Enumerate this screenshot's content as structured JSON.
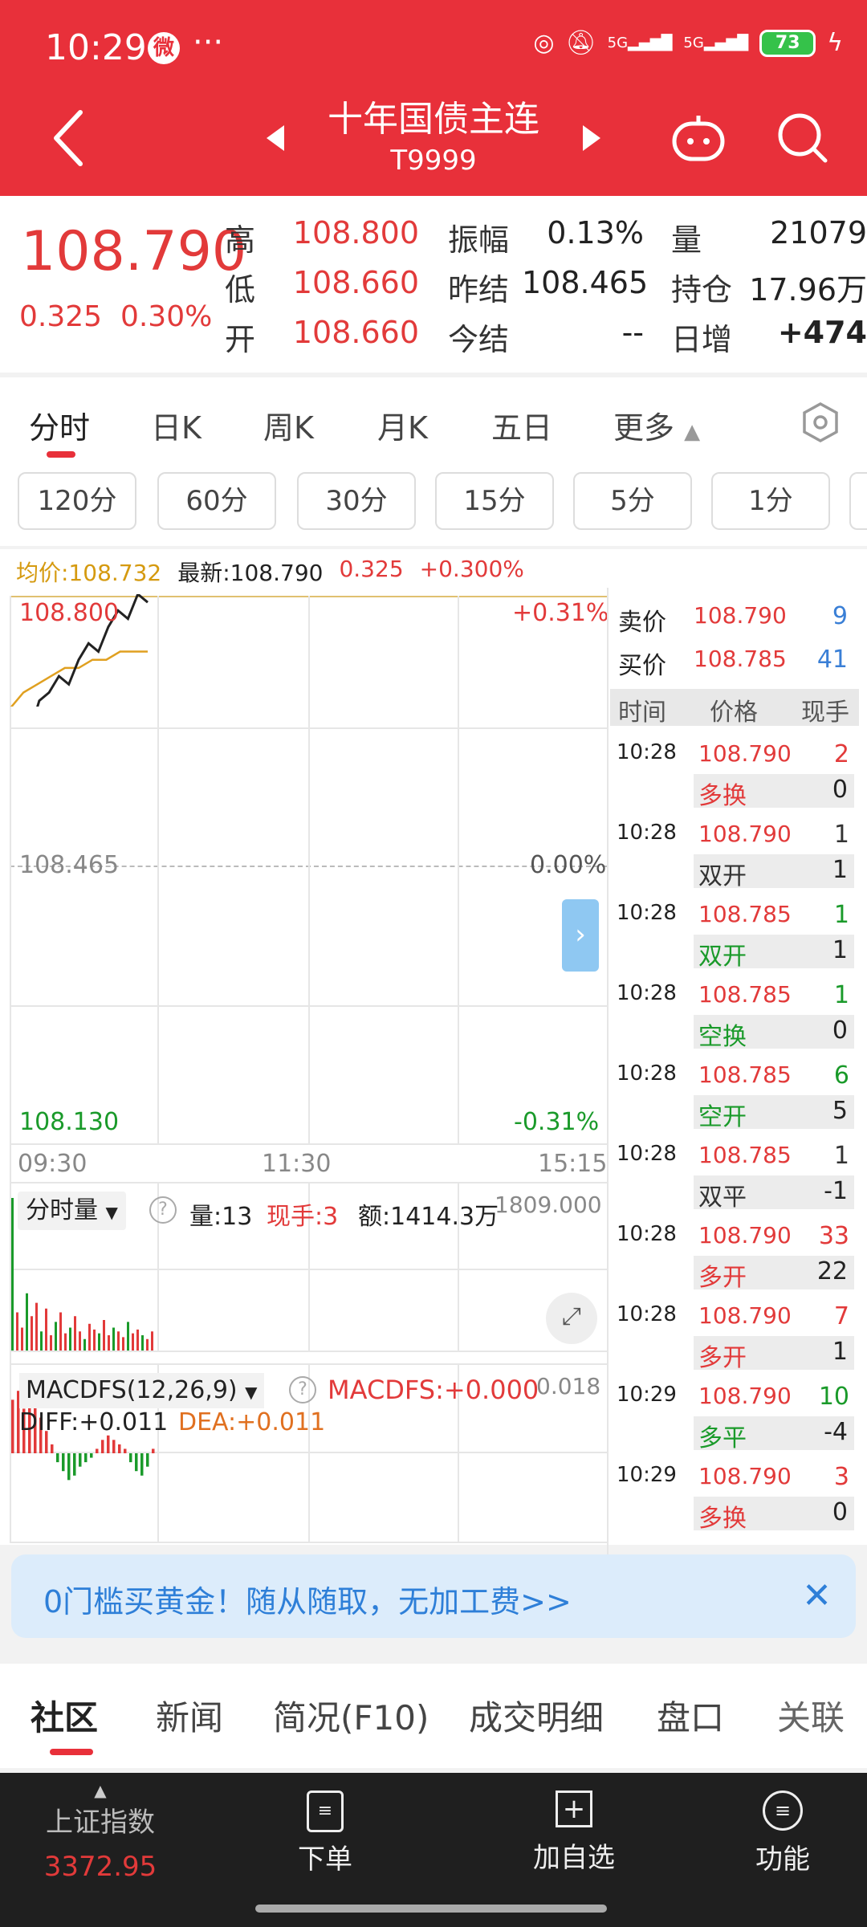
{
  "status": {
    "time": "10:29",
    "more": "···",
    "weibo_glyph": "微",
    "net1": "5G",
    "net2": "5G",
    "battery": "73"
  },
  "header": {
    "title": "十年国债主连",
    "subtitle": "T9999"
  },
  "quote": {
    "price": "108.790",
    "change": "0.325",
    "change_pct": "0.30%",
    "rows": [
      {
        "l1": "高",
        "v1": "108.800",
        "l2": "振幅",
        "v2": "0.13%",
        "l3": "量",
        "v3": "21079"
      },
      {
        "l1": "低",
        "v1": "108.660",
        "l2": "昨结",
        "v2": "108.465",
        "l3": "持仓",
        "v3": "17.96万"
      },
      {
        "l1": "开",
        "v1": "108.660",
        "l2": "今结",
        "v2": "--",
        "l3": "日增",
        "v3": "+474"
      }
    ]
  },
  "tabs": [
    "分时",
    "日K",
    "周K",
    "月K",
    "五日",
    "更多"
  ],
  "chips": [
    "120分",
    "60分",
    "30分",
    "15分",
    "5分",
    "1分"
  ],
  "chart": {
    "avg_price": "均价:108.732",
    "latest": "最新:108.790",
    "chg": "0.325",
    "chg_pct": "+0.300%",
    "y_high": "108.800",
    "y_mid": "108.465",
    "y_low": "108.130",
    "pct_high": "+0.31%",
    "pct_mid": "0.00%",
    "pct_low": "-0.31%",
    "t_start": "09:30",
    "t_mid": "11:30",
    "t_end": "15:15",
    "vol_label": "分时量",
    "vol_amount": "量:13",
    "vol_hand": "现手:3",
    "vol_money": "额:1414.3万",
    "vol_max": "1809.000",
    "macd_label": "MACDFS(12,26,9)",
    "macd_val": "MACDFS:+0.000",
    "macd_max": "0.018",
    "diff": "DIFF:+0.011",
    "dea": "DEA:+0.011",
    "price_curve": [
      108.6,
      108.64,
      108.63,
      108.67,
      108.68,
      108.7,
      108.69,
      108.72,
      108.74,
      108.73,
      108.76,
      108.78,
      108.77,
      108.8,
      108.79
    ],
    "avg_curve": [
      108.66,
      108.68,
      108.69,
      108.7,
      108.71,
      108.71,
      108.72,
      108.72,
      108.73,
      108.73,
      108.73
    ],
    "volumes": [
      80,
      20,
      12,
      30,
      18,
      25,
      10,
      22,
      8,
      15,
      20,
      9,
      12,
      18,
      10,
      6,
      14,
      11,
      9,
      16,
      8,
      12,
      10,
      7,
      15,
      9,
      11,
      8,
      6,
      10
    ],
    "macd_bars": [
      0.012,
      0.014,
      0.01,
      0.016,
      0.013,
      0.008,
      0.005,
      0.002,
      -0.002,
      -0.004,
      -0.006,
      -0.005,
      -0.003,
      -0.002,
      -0.001,
      0.001,
      0.003,
      0.004,
      0.003,
      0.002,
      0.001,
      -0.002,
      -0.004,
      -0.005,
      -0.003,
      0.001
    ]
  },
  "book": {
    "sell_label": "卖价",
    "sell_price": "108.790",
    "sell_vol": "9",
    "buy_label": "买价",
    "buy_price": "108.785",
    "buy_vol": "41",
    "head_time": "时间",
    "head_price": "价格",
    "head_hand": "现手",
    "trades": [
      {
        "time": "10:28",
        "price": "108.790",
        "hand": "2",
        "type": "多换",
        "oi": "0",
        "hand_color": "red",
        "type_color": "red"
      },
      {
        "time": "10:28",
        "price": "108.790",
        "hand": "1",
        "type": "双开",
        "oi": "1",
        "hand_color": "dark",
        "type_color": "dark"
      },
      {
        "time": "10:28",
        "price": "108.785",
        "hand": "1",
        "type": "双开",
        "oi": "1",
        "hand_color": "green",
        "type_color": "green"
      },
      {
        "time": "10:28",
        "price": "108.785",
        "hand": "1",
        "type": "空换",
        "oi": "0",
        "hand_color": "green",
        "type_color": "green"
      },
      {
        "time": "10:28",
        "price": "108.785",
        "hand": "6",
        "type": "空开",
        "oi": "5",
        "hand_color": "green",
        "type_color": "green"
      },
      {
        "time": "10:28",
        "price": "108.785",
        "hand": "1",
        "type": "双平",
        "oi": "-1",
        "hand_color": "dark",
        "type_color": "dark"
      },
      {
        "time": "10:28",
        "price": "108.790",
        "hand": "33",
        "type": "多开",
        "oi": "22",
        "hand_color": "red",
        "type_color": "red"
      },
      {
        "time": "10:28",
        "price": "108.790",
        "hand": "7",
        "type": "多开",
        "oi": "1",
        "hand_color": "red",
        "type_color": "red"
      },
      {
        "time": "10:29",
        "price": "108.790",
        "hand": "10",
        "type": "多平",
        "oi": "-4",
        "hand_color": "green",
        "type_color": "green"
      },
      {
        "time": "10:29",
        "price": "108.790",
        "hand": "3",
        "type": "多换",
        "oi": "0",
        "hand_color": "red",
        "type_color": "red"
      }
    ]
  },
  "ad": {
    "text": "0门槛买黄金！随从随取，无加工费>>"
  },
  "bottom_tabs": [
    "社区",
    "新闻",
    "简况(F10)",
    "成交明细",
    "盘口",
    "关联"
  ],
  "nav": {
    "index_name": "上证指数",
    "index_value": "3372.95",
    "order": "下单",
    "add": "加自选",
    "func": "功能"
  },
  "colors": {
    "brand_red": "#e8303a",
    "up": "#e23a3a",
    "down": "#1a9a2a",
    "avg_line": "#e0a020"
  }
}
